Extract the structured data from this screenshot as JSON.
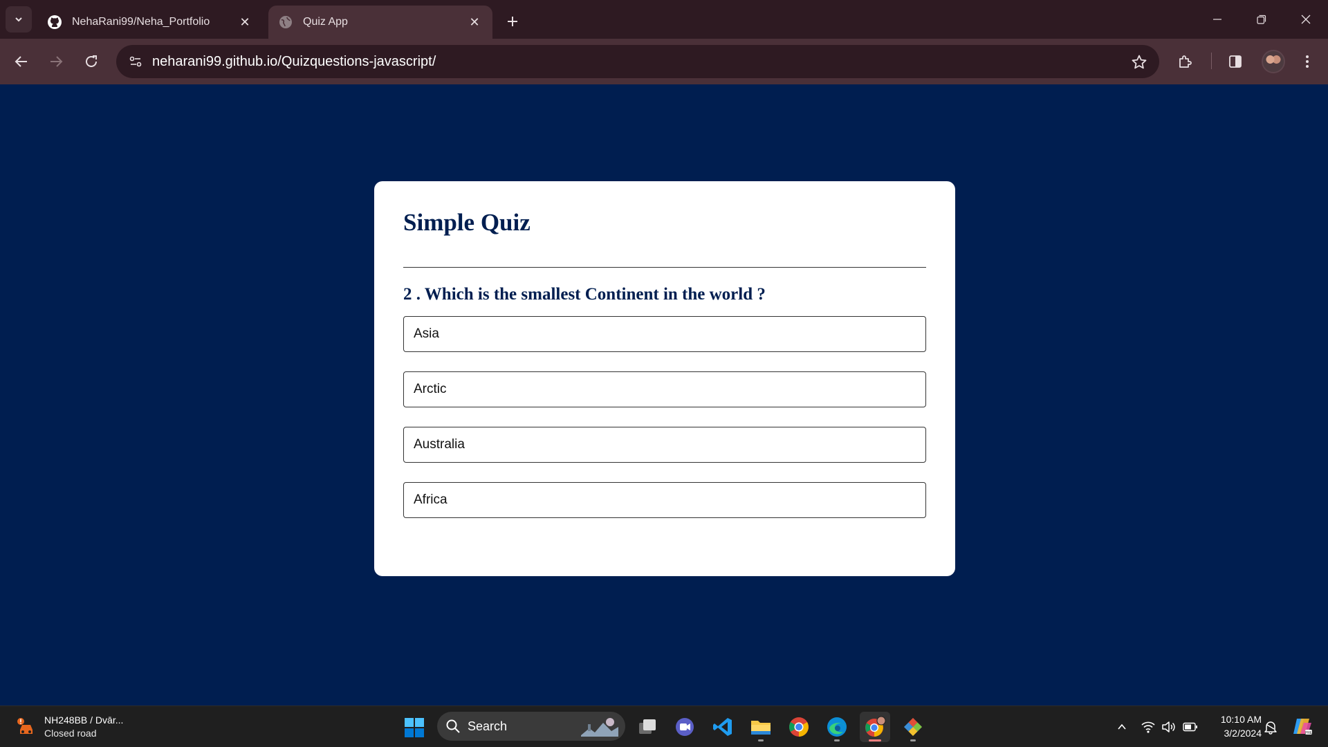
{
  "browser": {
    "tabs": [
      {
        "title": "NehaRani99/Neha_Portfolio",
        "icon": "github-icon",
        "active": false
      },
      {
        "title": "Quiz App",
        "icon": "globe-icon",
        "active": true
      }
    ],
    "url": "neharani99.github.io/Quizquestions-javascript/"
  },
  "quiz": {
    "title": "Simple Quiz",
    "question": "2 . Which is the smallest Continent in the world ?",
    "options": [
      "Asia",
      "Arctic",
      "Australia",
      "Africa"
    ]
  },
  "taskbar": {
    "weather_title": "NH248BB / Dvār...",
    "weather_subtitle": "Closed road",
    "search_placeholder": "Search",
    "time": "10:10 AM",
    "date": "3/2/2024"
  },
  "colors": {
    "page_background": "#001e50",
    "card_background": "#ffffff",
    "title_color": "#001e50",
    "chrome_titlebar": "#2e1a22",
    "chrome_toolbar": "#4a3038"
  }
}
